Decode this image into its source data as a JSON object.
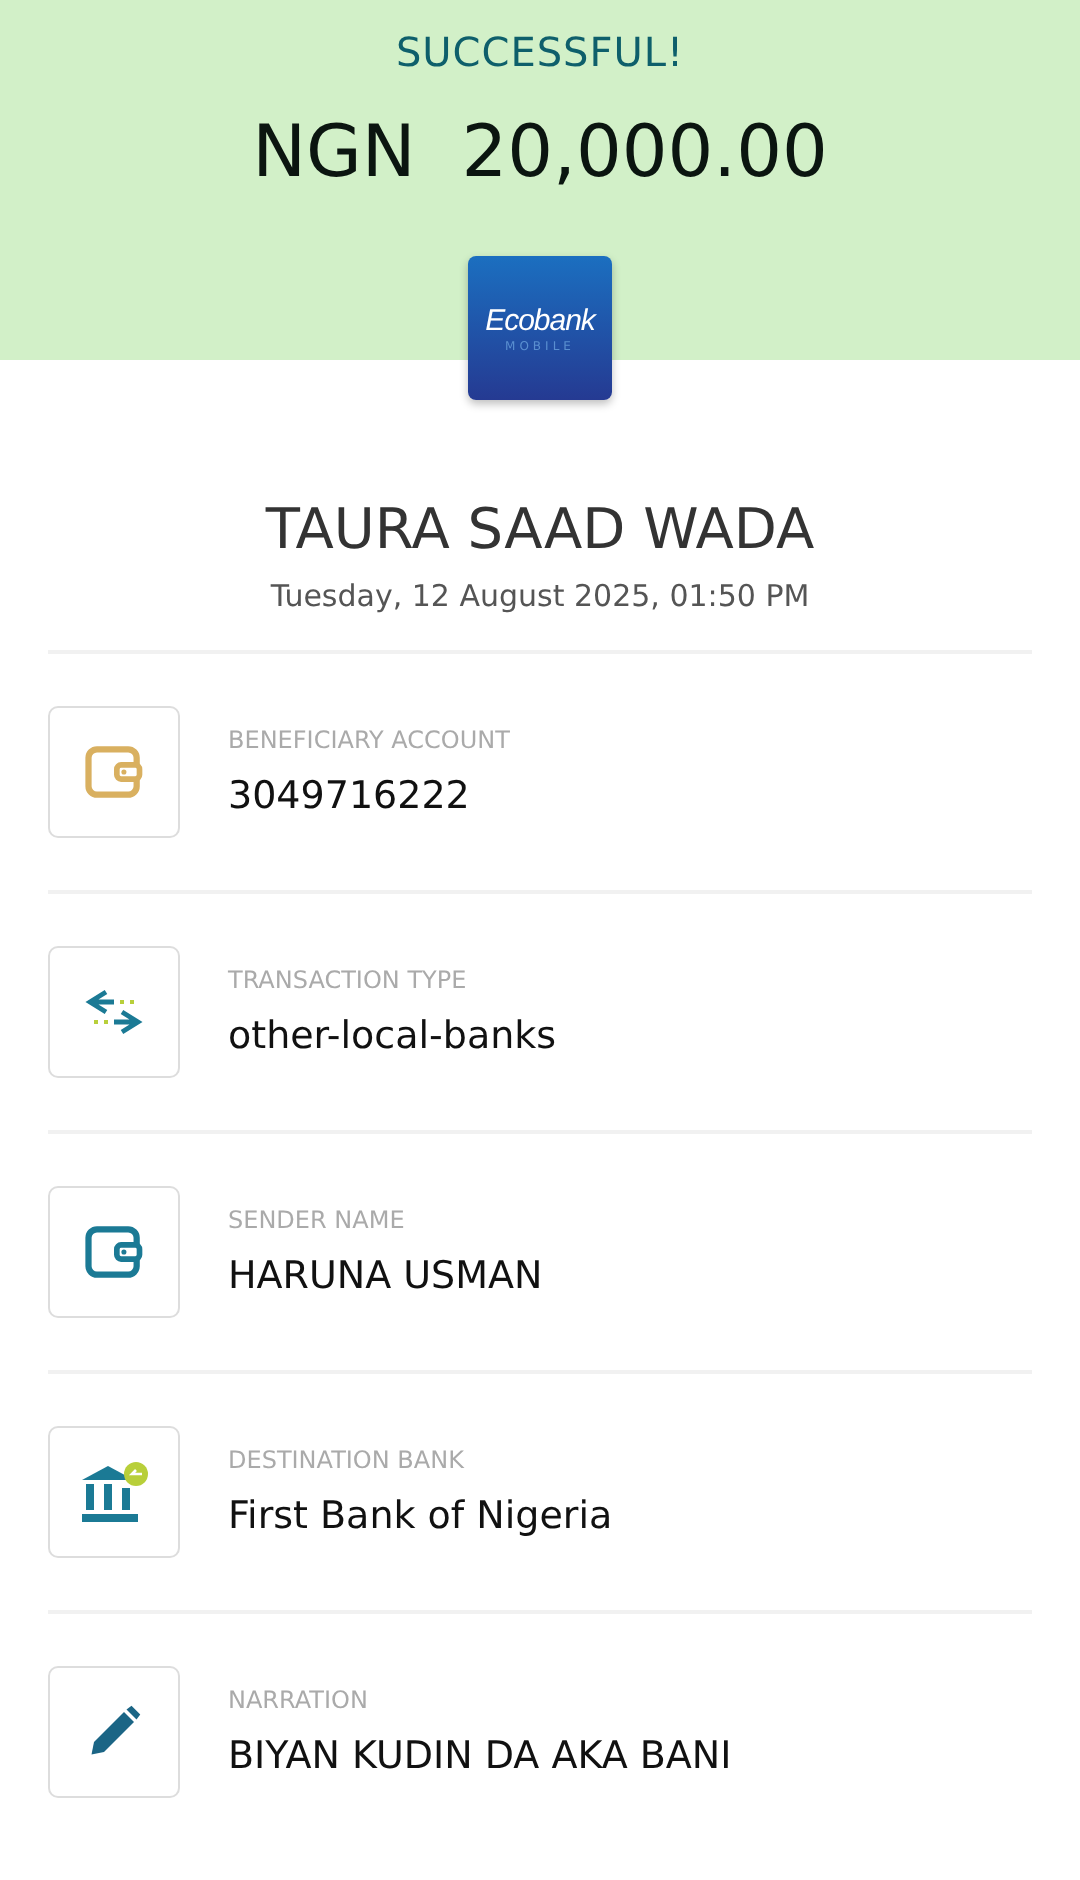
{
  "header": {
    "status": "SUCCESSFUL!",
    "amount": "NGN  20,000.00"
  },
  "logo": {
    "name": "Ecobank",
    "tagline": "MOBILE"
  },
  "recipient": {
    "name": "TAURA SAAD WADA",
    "datetime": "Tuesday, 12 August 2025, 01:50 PM"
  },
  "details": [
    {
      "kind": "account",
      "label": "BENEFICIARY ACCOUNT",
      "value": "3049716222"
    },
    {
      "kind": "transfer",
      "label": "TRANSACTION TYPE",
      "value": "other-local-banks"
    },
    {
      "kind": "sender",
      "label": "SENDER NAME",
      "value": "HARUNA USMAN"
    },
    {
      "kind": "bank",
      "label": "DESTINATION BANK",
      "value": "First Bank of Nigeria"
    },
    {
      "kind": "narration",
      "label": "NARRATION",
      "value": "BIYAN KUDIN DA AKA BANI"
    }
  ]
}
